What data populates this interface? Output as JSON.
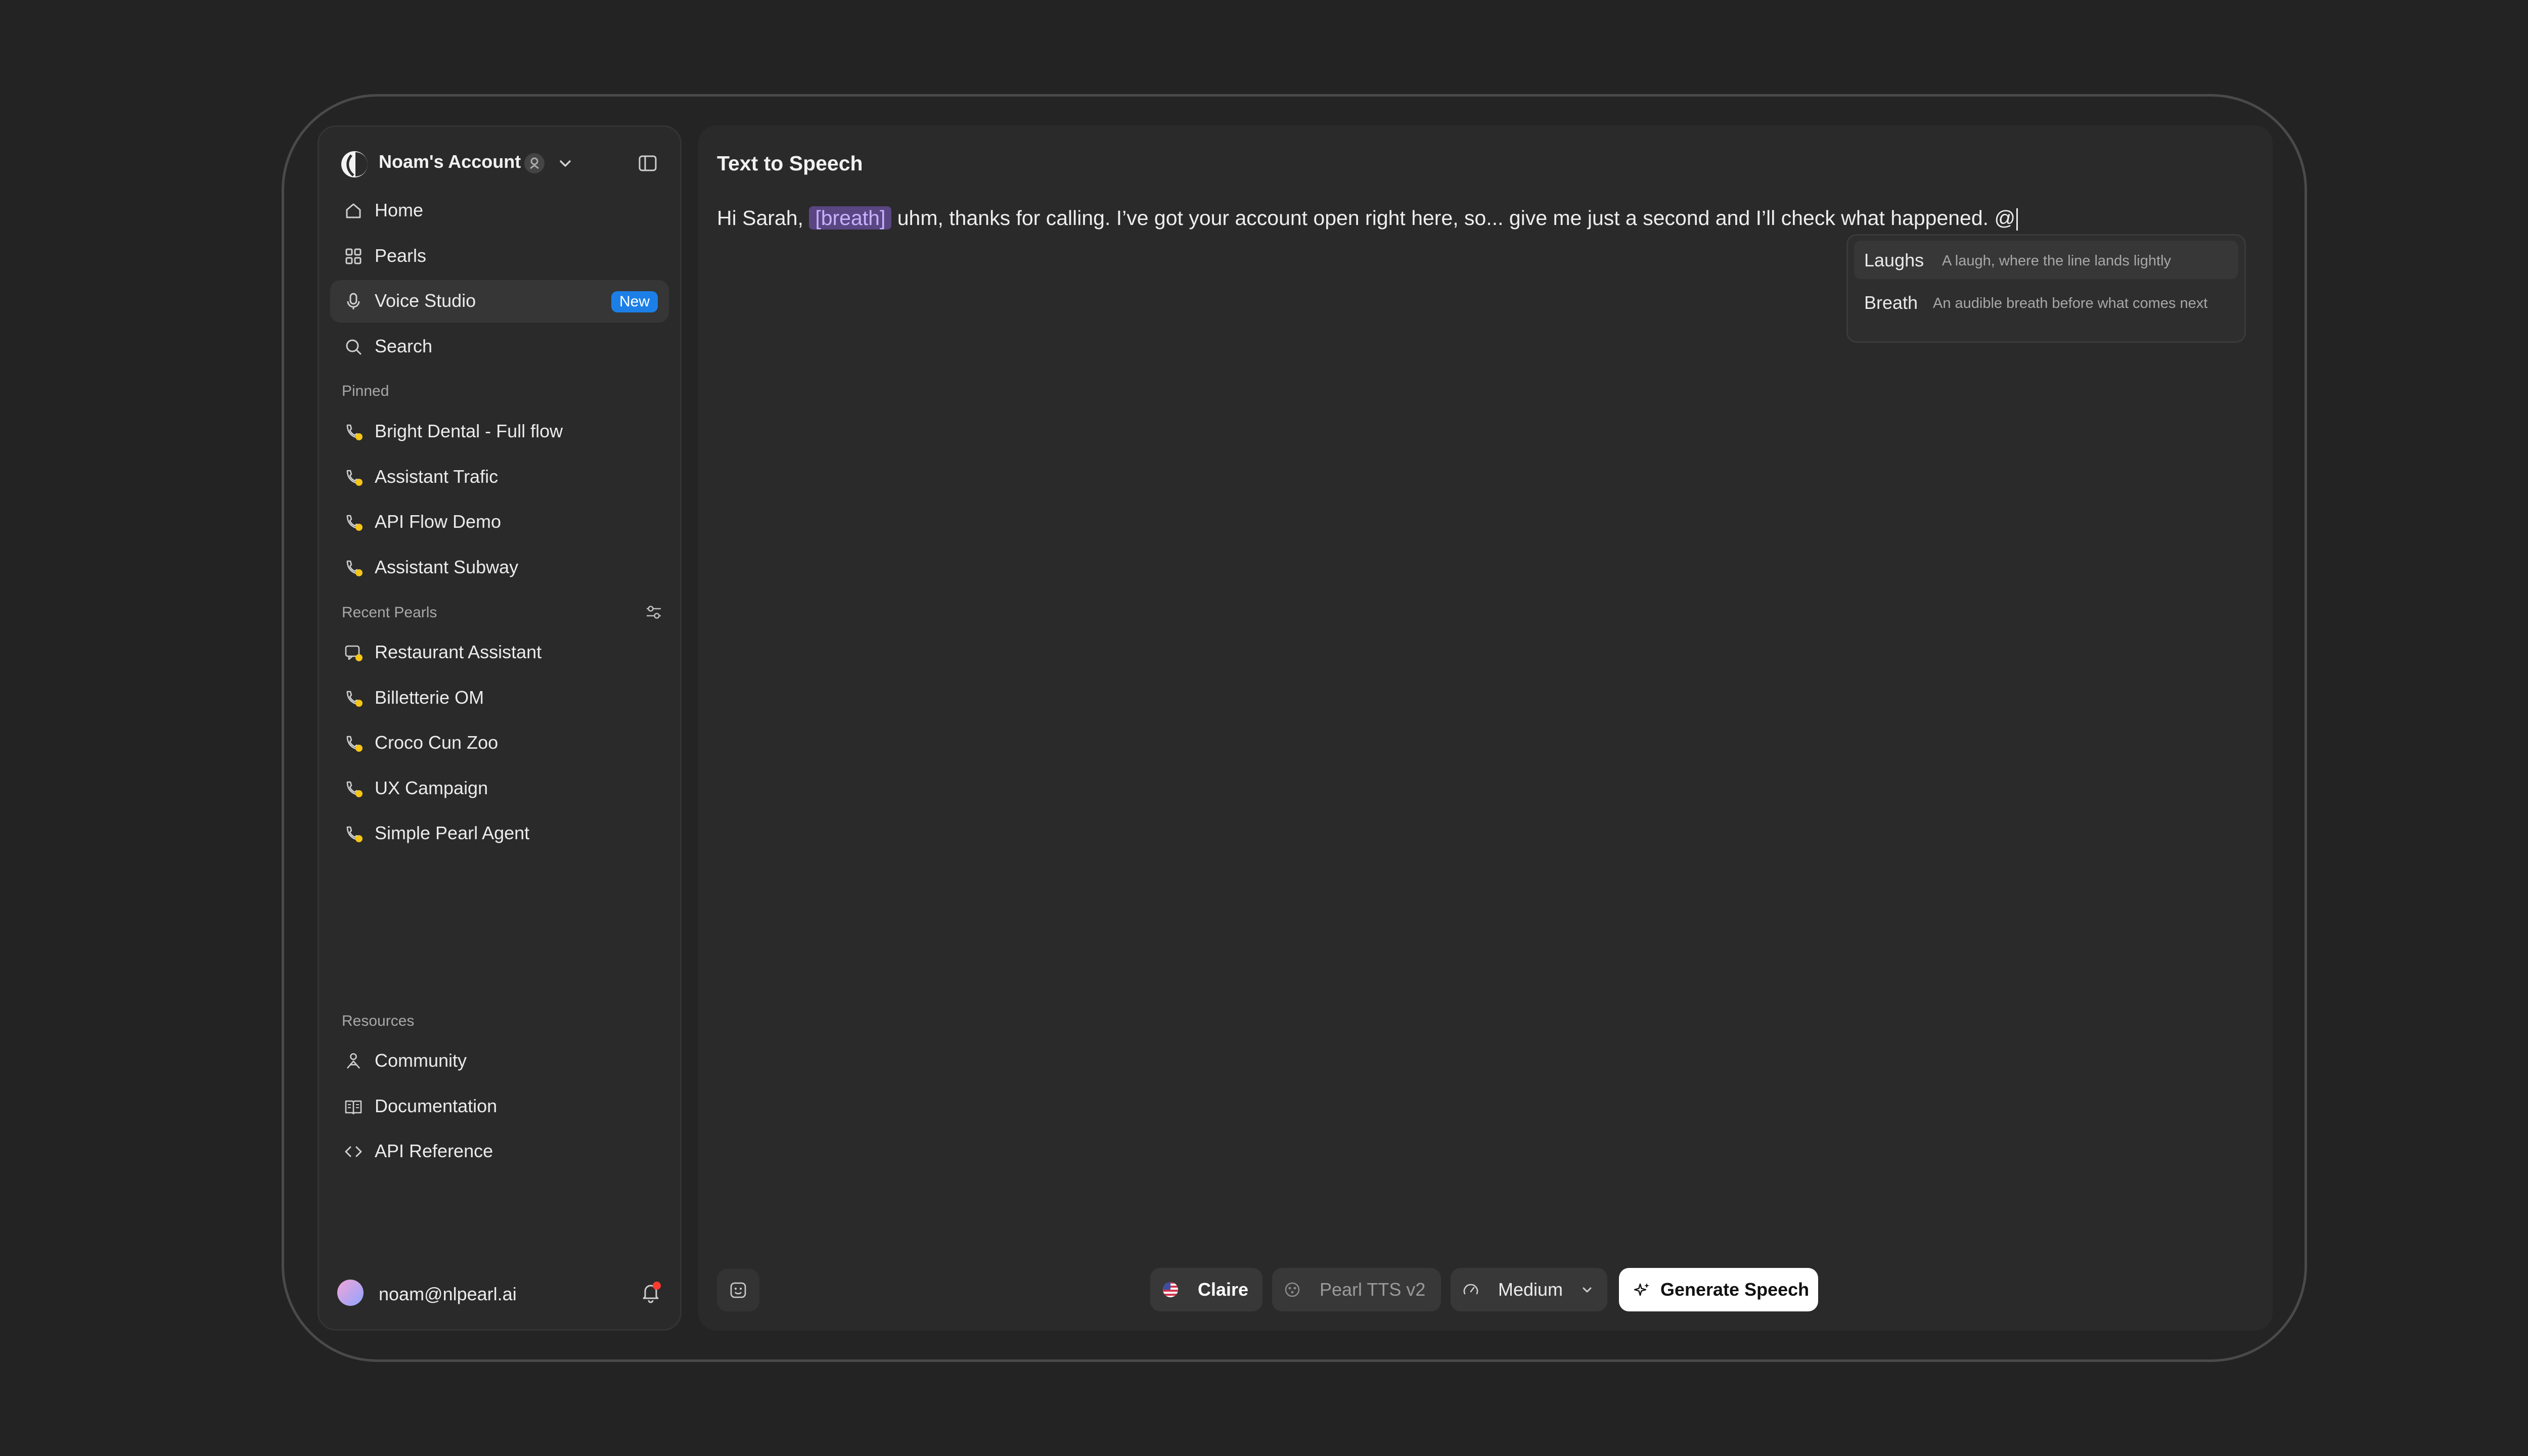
{
  "account": {
    "name": "Noam's Account"
  },
  "nav": [
    {
      "label": "Home",
      "icon": "home-icon"
    },
    {
      "label": "Pearls",
      "icon": "grid-icon"
    },
    {
      "label": "Voice Studio",
      "icon": "microphone-icon",
      "badge": "New",
      "active": true
    },
    {
      "label": "Search",
      "icon": "search-icon"
    }
  ],
  "pinned": {
    "label": "Pinned",
    "items": [
      "Bright Dental - Full flow",
      "Assistant Trafic",
      "API Flow Demo",
      "Assistant Subway"
    ]
  },
  "recent": {
    "label": "Recent Pearls",
    "items": [
      "Restaurant Assistant",
      "Billetterie OM",
      "Croco Cun Zoo",
      "UX Campaign",
      "Simple Pearl Agent"
    ]
  },
  "resources": {
    "label": "Resources",
    "items": [
      {
        "label": "Community",
        "icon": "community-icon"
      },
      {
        "label": "Documentation",
        "icon": "book-icon"
      },
      {
        "label": "API Reference",
        "icon": "code-icon"
      }
    ]
  },
  "user": {
    "email": "noam@nlpearl.ai"
  },
  "main": {
    "title": "Text to Speech",
    "text_before": "Hi Sarah, ",
    "tag": "[breath]",
    "text_after": " uhm, thanks for calling. I’ve got your account open right here, so... give me just a second and I’ll check what happened. @"
  },
  "suggestions": [
    {
      "label": "Laughs",
      "desc": "A laugh, where the line lands lightly"
    },
    {
      "label": "Breath",
      "desc": "An audible breath before what comes next"
    }
  ],
  "toolbar": {
    "voice": "Claire",
    "model": "Pearl TTS v2",
    "speed": "Medium",
    "generate": "Generate Speech"
  },
  "colors": {
    "accent_blue": "#1c7fe8",
    "tag_bg": "#5a4682",
    "tag_text": "#c6b2ff",
    "status_dot": "#f5c518",
    "notification_dot": "#ff3b30"
  }
}
